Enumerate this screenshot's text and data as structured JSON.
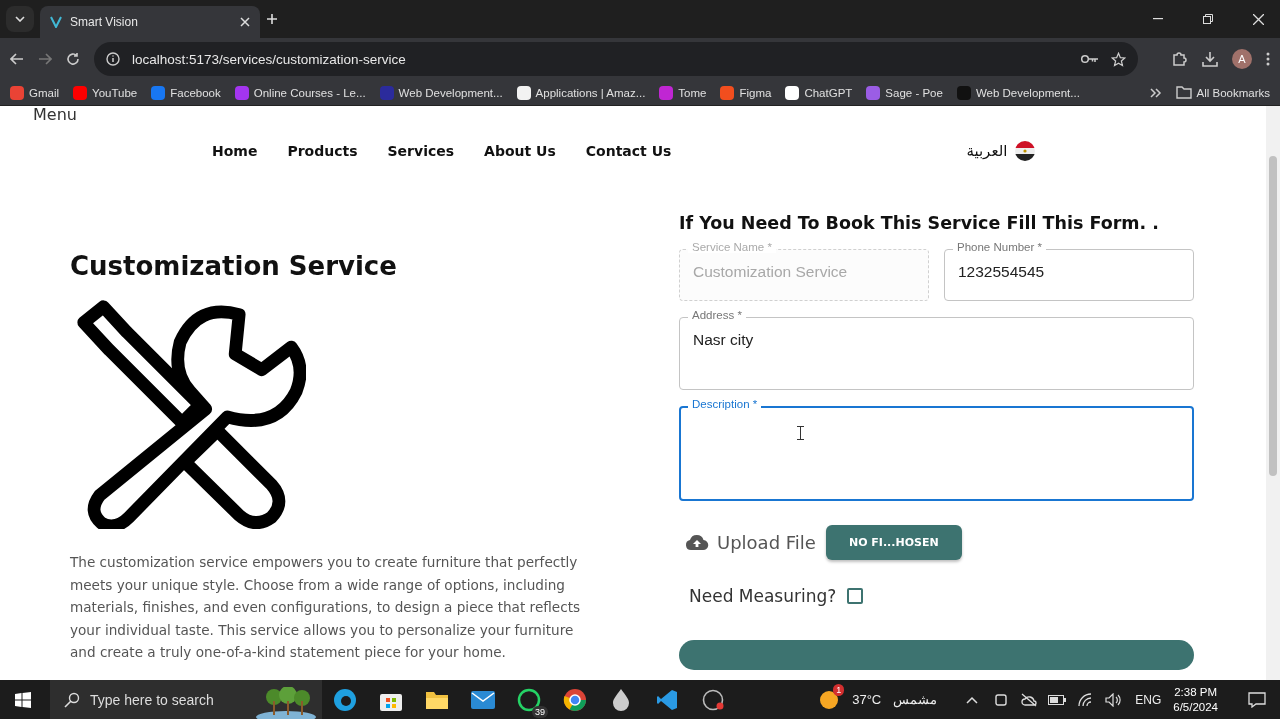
{
  "browser": {
    "tabs": [
      {
        "title": "Smart Vision",
        "selected": true
      }
    ],
    "url": "localhost:5173/services/customization-service",
    "profile_initial": "A",
    "bookmarks": [
      {
        "label": "Gmail",
        "color": "#ea4335"
      },
      {
        "label": "YouTube",
        "color": "#ff0000"
      },
      {
        "label": "Facebook",
        "color": "#1877f2"
      },
      {
        "label": "Online Courses - Le...",
        "color": "#a435f0"
      },
      {
        "label": "Web Development...",
        "color": "#2b2b9c"
      },
      {
        "label": "Applications | Amaz...",
        "color": "#f2f2f2"
      },
      {
        "label": "Tome",
        "color": "#c026d3"
      },
      {
        "label": "Figma",
        "color": "#f24e1e"
      },
      {
        "label": "ChatGPT",
        "color": "#ffffff"
      },
      {
        "label": "Sage - Poe",
        "color": "#9b5de5"
      },
      {
        "label": "Web Development...",
        "color": "#111111"
      }
    ],
    "all_bookmarks": "All Bookmarks"
  },
  "page": {
    "menu_label": "Menu",
    "nav": [
      {
        "label": "Home"
      },
      {
        "label": "Products"
      },
      {
        "label": "Services"
      },
      {
        "label": "About Us"
      },
      {
        "label": "Contact Us"
      }
    ],
    "language": "العربية",
    "service": {
      "title": "Customization Service",
      "description": "The customization service empowers you to create furniture that perfectly meets your unique style. Choose from a wide range of options, including materials, finishes, and even configurations, to design a piece that reflects your individual taste. This service allows you to personalize your furniture and create a truly one-of-a-kind statement piece for your home."
    },
    "form": {
      "title": "If You Need To Book This Service Fill This Form. .",
      "fields": [
        {
          "label": "Service Name *",
          "value": "Customization Service",
          "kind": "text",
          "disabled": true,
          "focused": false
        },
        {
          "label": "Phone Number *",
          "value": "1232554545",
          "kind": "text",
          "disabled": false,
          "focused": false
        },
        {
          "label": "Address *",
          "value": "Nasr city",
          "kind": "textarea",
          "disabled": false,
          "focused": false
        },
        {
          "label": "Description *",
          "kind": "textarea",
          "disabled": false,
          "focused": true
        }
      ],
      "upload": {
        "label": "Upload File",
        "button": "NO FI...HOSEN"
      },
      "measuring": {
        "label": "Need Measuring?",
        "checked": false
      }
    }
  },
  "taskbar": {
    "search_placeholder": "Type here to search",
    "whatsapp_badge": "39",
    "weather_badge": "1",
    "temperature": "37°C",
    "weather": "مشمس",
    "language": "ENG",
    "time": "2:38 PM",
    "date": "6/5/2024"
  }
}
